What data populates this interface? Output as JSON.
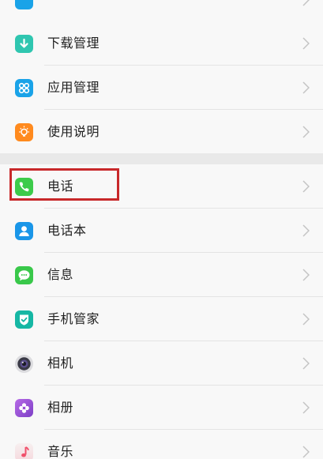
{
  "colors": {
    "highlight": "#c8282a",
    "download": "#2fc6b0",
    "apps": "#1aa3e8",
    "guide": "#ff8a1e",
    "phone": "#3ccb4a",
    "contacts": "#1a96e8",
    "messages": "#39c84a",
    "phone_manager": "#16b7a4",
    "camera": "#3a3a46",
    "gallery": "#9a4fd6",
    "music": "#f0506b"
  },
  "settings": {
    "group1": [
      {
        "id": "download-manager",
        "label": "下载管理",
        "icon": "download-icon"
      },
      {
        "id": "app-manager",
        "label": "应用管理",
        "icon": "apps-grid-icon"
      },
      {
        "id": "user-guide",
        "label": "使用说明",
        "icon": "lightbulb-icon"
      }
    ],
    "group2": [
      {
        "id": "phone",
        "label": "电话",
        "icon": "phone-icon"
      },
      {
        "id": "contacts",
        "label": "电话本",
        "icon": "contacts-icon"
      },
      {
        "id": "messages",
        "label": "信息",
        "icon": "message-icon"
      },
      {
        "id": "phone-manager",
        "label": "手机管家",
        "icon": "shield-icon"
      },
      {
        "id": "camera",
        "label": "相机",
        "icon": "camera-icon"
      },
      {
        "id": "gallery",
        "label": "相册",
        "icon": "flower-icon"
      },
      {
        "id": "music",
        "label": "音乐",
        "icon": "music-note-icon"
      }
    ]
  }
}
